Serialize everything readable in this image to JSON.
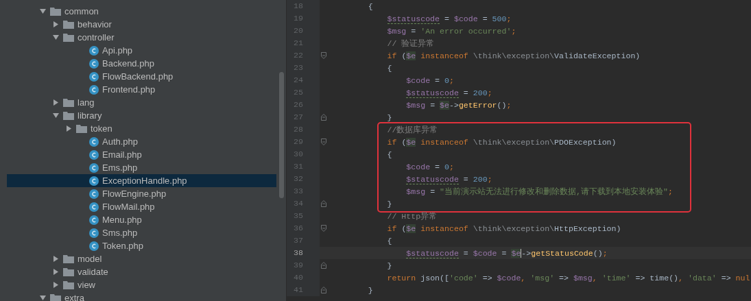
{
  "tree": [
    {
      "label": "common",
      "kind": "folder",
      "expanded": true,
      "selected": false,
      "children": [
        {
          "label": "behavior",
          "kind": "folder",
          "expanded": false,
          "selected": false
        },
        {
          "label": "controller",
          "kind": "folder",
          "expanded": true,
          "selected": false,
          "children": [
            {
              "label": "Api.php",
              "kind": "php",
              "selected": false
            },
            {
              "label": "Backend.php",
              "kind": "php",
              "selected": false
            },
            {
              "label": "FlowBackend.php",
              "kind": "php",
              "selected": false
            },
            {
              "label": "Frontend.php",
              "kind": "php",
              "selected": false
            }
          ]
        },
        {
          "label": "lang",
          "kind": "folder",
          "expanded": false,
          "selected": false
        },
        {
          "label": "library",
          "kind": "folder",
          "expanded": true,
          "selected": false,
          "children": [
            {
              "label": "token",
              "kind": "folder",
              "expanded": false,
              "selected": false
            },
            {
              "label": "Auth.php",
              "kind": "php",
              "selected": false
            },
            {
              "label": "Email.php",
              "kind": "php",
              "selected": false
            },
            {
              "label": "Ems.php",
              "kind": "php",
              "selected": false
            },
            {
              "label": "ExceptionHandle.php",
              "kind": "php",
              "selected": true
            },
            {
              "label": "FlowEngine.php",
              "kind": "php",
              "selected": false
            },
            {
              "label": "FlowMail.php",
              "kind": "php",
              "selected": false
            },
            {
              "label": "Menu.php",
              "kind": "php",
              "selected": false
            },
            {
              "label": "Sms.php",
              "kind": "php",
              "selected": false
            },
            {
              "label": "Token.php",
              "kind": "php",
              "selected": false
            }
          ]
        },
        {
          "label": "model",
          "kind": "folder",
          "expanded": false,
          "selected": false
        },
        {
          "label": "validate",
          "kind": "folder",
          "expanded": false,
          "selected": false
        },
        {
          "label": "view",
          "kind": "folder",
          "expanded": false,
          "selected": false
        }
      ]
    },
    {
      "label": "extra",
      "kind": "folder",
      "expanded": true,
      "selected": false
    }
  ],
  "code": {
    "blocks": [
      {
        "highlighted": false,
        "lines": [
          {
            "number": "18",
            "current": false,
            "tokens": [
              {
                "kind": "plain",
                "text": "        {"
              }
            ]
          },
          {
            "number": "19",
            "current": false,
            "tokens": [
              {
                "kind": "var",
                "warn": true,
                "text": "            $statuscode"
              },
              {
                "kind": "plain",
                "text": " = "
              },
              {
                "kind": "var",
                "text": "$code"
              },
              {
                "kind": "plain",
                "text": " = "
              },
              {
                "kind": "num",
                "text": "500"
              },
              {
                "kind": "kw",
                "text": ";"
              }
            ]
          },
          {
            "number": "20",
            "current": false,
            "tokens": [
              {
                "kind": "var",
                "text": "            $msg"
              },
              {
                "kind": "plain",
                "text": " = "
              },
              {
                "kind": "str",
                "text": "'An error occurred'"
              },
              {
                "kind": "kw",
                "text": ";"
              }
            ]
          },
          {
            "number": "21",
            "current": false,
            "tokens": [
              {
                "kind": "cmt",
                "text": "            // 验证异常"
              }
            ]
          },
          {
            "number": "22",
            "current": false,
            "fold_start": true,
            "tokens": [
              {
                "kind": "kw",
                "text": "            if"
              },
              {
                "kind": "plain",
                "text": " ("
              },
              {
                "kind": "var",
                "marked": true,
                "text": "$e"
              },
              {
                "kind": "kw",
                "text": " instanceof"
              },
              {
                "kind": "ns",
                "text": " \\think\\exception\\"
              },
              {
                "kind": "plain",
                "text": "ValidateException)"
              }
            ]
          },
          {
            "number": "23",
            "current": false,
            "tokens": [
              {
                "kind": "plain",
                "text": "            {"
              }
            ]
          },
          {
            "number": "24",
            "current": false,
            "tokens": [
              {
                "kind": "var",
                "text": "                $code"
              },
              {
                "kind": "plain",
                "text": " = "
              },
              {
                "kind": "num",
                "text": "0"
              },
              {
                "kind": "kw",
                "text": ";"
              }
            ]
          },
          {
            "number": "25",
            "current": false,
            "tokens": [
              {
                "kind": "var",
                "warn": true,
                "text": "                $statuscode"
              },
              {
                "kind": "plain",
                "text": " = "
              },
              {
                "kind": "num",
                "text": "200"
              },
              {
                "kind": "kw",
                "text": ";"
              }
            ]
          },
          {
            "number": "26",
            "current": false,
            "tokens": [
              {
                "kind": "var",
                "text": "                $msg"
              },
              {
                "kind": "plain",
                "text": " = "
              },
              {
                "kind": "var",
                "marked": true,
                "text": "$e"
              },
              {
                "kind": "plain",
                "text": "->"
              },
              {
                "kind": "fn",
                "text": "getError"
              },
              {
                "kind": "plain",
                "text": "()"
              },
              {
                "kind": "kw",
                "text": ";"
              }
            ]
          },
          {
            "number": "27",
            "current": false,
            "fold_end": true,
            "tokens": [
              {
                "kind": "plain",
                "text": "            }"
              }
            ]
          }
        ]
      },
      {
        "highlighted": true,
        "lines": [
          {
            "number": "28",
            "current": false,
            "tokens": [
              {
                "kind": "cmt",
                "text": "            //数据库异常"
              }
            ]
          },
          {
            "number": "29",
            "current": false,
            "fold_start": true,
            "tokens": [
              {
                "kind": "kw",
                "text": "            if"
              },
              {
                "kind": "plain",
                "text": " ("
              },
              {
                "kind": "var",
                "marked": true,
                "text": "$e"
              },
              {
                "kind": "kw",
                "text": " instanceof"
              },
              {
                "kind": "ns",
                "text": " \\think\\exception\\"
              },
              {
                "kind": "plain",
                "text": "PDOException)"
              }
            ]
          },
          {
            "number": "30",
            "current": false,
            "tokens": [
              {
                "kind": "plain",
                "text": "            {"
              }
            ]
          },
          {
            "number": "31",
            "current": false,
            "tokens": [
              {
                "kind": "var",
                "text": "                $code"
              },
              {
                "kind": "plain",
                "text": " = "
              },
              {
                "kind": "num",
                "text": "0"
              },
              {
                "kind": "kw",
                "text": ";"
              }
            ]
          },
          {
            "number": "32",
            "current": false,
            "tokens": [
              {
                "kind": "var",
                "warn": true,
                "text": "                $statuscode"
              },
              {
                "kind": "plain",
                "text": " = "
              },
              {
                "kind": "num",
                "text": "200"
              },
              {
                "kind": "kw",
                "text": ";"
              }
            ]
          },
          {
            "number": "33",
            "current": false,
            "tokens": [
              {
                "kind": "var",
                "text": "                $msg"
              },
              {
                "kind": "plain",
                "text": " = "
              },
              {
                "kind": "str",
                "text": "\"当前演示站无法进行修改和删除数据,请下载到本地安装体验\""
              },
              {
                "kind": "kw",
                "text": ";"
              }
            ]
          },
          {
            "number": "34",
            "current": false,
            "fold_end": true,
            "tokens": [
              {
                "kind": "plain",
                "text": "            }"
              }
            ]
          }
        ]
      },
      {
        "highlighted": false,
        "lines": [
          {
            "number": "35",
            "current": false,
            "tokens": [
              {
                "kind": "cmt",
                "text": "            // Http异常"
              }
            ]
          },
          {
            "number": "36",
            "current": false,
            "fold_start": true,
            "tokens": [
              {
                "kind": "kw",
                "text": "            if"
              },
              {
                "kind": "plain",
                "text": " ("
              },
              {
                "kind": "var",
                "marked": true,
                "text": "$e"
              },
              {
                "kind": "kw",
                "text": " instanceof"
              },
              {
                "kind": "ns",
                "text": " \\think\\exception\\"
              },
              {
                "kind": "plain",
                "text": "HttpException)"
              }
            ]
          },
          {
            "number": "37",
            "current": false,
            "tokens": [
              {
                "kind": "plain",
                "text": "            {"
              }
            ]
          },
          {
            "number": "38",
            "current": true,
            "tokens": [
              {
                "kind": "var",
                "warn": true,
                "text": "                $statuscode"
              },
              {
                "kind": "plain",
                "text": " = "
              },
              {
                "kind": "var",
                "text": "$code"
              },
              {
                "kind": "plain",
                "text": " = "
              },
              {
                "kind": "var",
                "marked": true,
                "cursor": true,
                "text": "$e"
              },
              {
                "kind": "plain",
                "text": "->"
              },
              {
                "kind": "fn",
                "text": "getStatusCode"
              },
              {
                "kind": "plain",
                "text": "()"
              },
              {
                "kind": "kw",
                "text": ";"
              }
            ]
          },
          {
            "number": "39",
            "current": false,
            "fold_end": true,
            "tokens": [
              {
                "kind": "plain",
                "text": "            }"
              }
            ]
          },
          {
            "number": "40",
            "current": false,
            "tokens": [
              {
                "kind": "kw",
                "text": "            return"
              },
              {
                "kind": "plain",
                "text": " json(["
              },
              {
                "kind": "str",
                "text": "'code'"
              },
              {
                "kind": "plain",
                "text": " => "
              },
              {
                "kind": "var",
                "text": "$code"
              },
              {
                "kind": "kw",
                "text": ","
              },
              {
                "kind": "str",
                "text": " 'msg'"
              },
              {
                "kind": "plain",
                "text": " => "
              },
              {
                "kind": "var",
                "text": "$msg"
              },
              {
                "kind": "kw",
                "text": ","
              },
              {
                "kind": "str",
                "text": " 'time'"
              },
              {
                "kind": "plain",
                "text": " => time()"
              },
              {
                "kind": "kw",
                "text": ","
              },
              {
                "kind": "str",
                "text": " 'data'"
              },
              {
                "kind": "plain",
                "text": " => "
              },
              {
                "kind": "kw",
                "text": "nul"
              }
            ]
          },
          {
            "number": "41",
            "current": false,
            "fold_end": true,
            "tokens": [
              {
                "kind": "plain",
                "text": "        }"
              }
            ]
          }
        ]
      }
    ]
  }
}
